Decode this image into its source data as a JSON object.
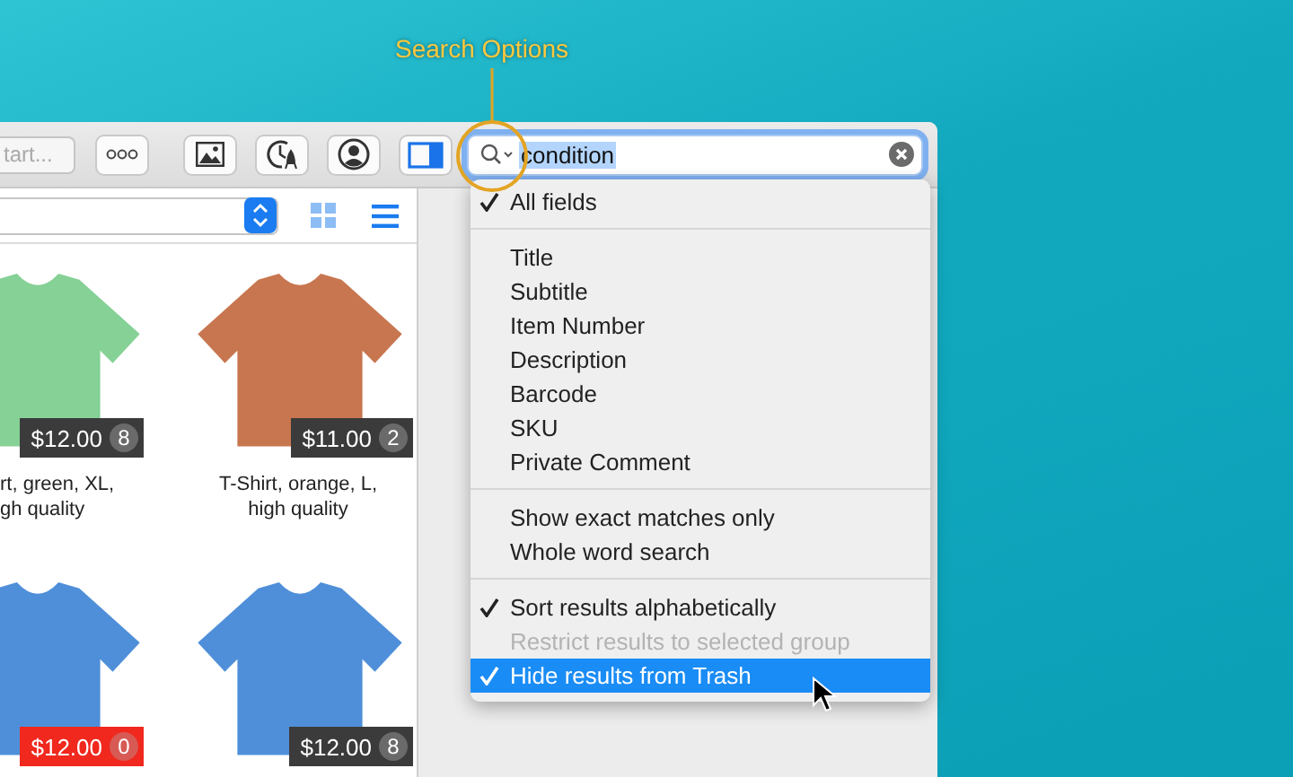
{
  "annotation": {
    "label": "Search Options"
  },
  "toolbar": {
    "start_field": {
      "placeholder": "tart..."
    },
    "buttons": [
      {
        "kind": "more"
      },
      {
        "kind": "image"
      },
      {
        "kind": "clock"
      },
      {
        "kind": "person"
      },
      {
        "kind": "sidebar",
        "on": true
      }
    ],
    "search": {
      "value": "condition",
      "text_selected": true
    }
  },
  "filter_bar": {
    "view_modes": [
      {
        "kind": "grid",
        "selected": false
      },
      {
        "kind": "list",
        "selected": true
      }
    ]
  },
  "products": [
    {
      "caption_lines": [
        "rt, green, XL,",
        "gh quality"
      ],
      "price": "$12.00",
      "count": "8",
      "color": "#85d196",
      "out_of_stock": false
    },
    {
      "caption_lines": [
        "T-Shirt, orange, L,",
        "high quality"
      ],
      "price": "$11.00",
      "count": "2",
      "color": "#c8764f",
      "out_of_stock": false
    },
    {
      "price": "$12.00",
      "count": "0",
      "color": "#4f8fd9",
      "out_of_stock": true
    },
    {
      "price": "$12.00",
      "count": "8",
      "color": "#4f8fd9",
      "out_of_stock": false
    }
  ],
  "search_menu": {
    "sections": [
      {
        "items": [
          {
            "label": "All fields",
            "checked": true,
            "disabled": false,
            "selected": false
          }
        ]
      },
      {
        "items": [
          {
            "label": "Title",
            "checked": false,
            "disabled": false,
            "selected": false
          },
          {
            "label": "Subtitle",
            "checked": false,
            "disabled": false,
            "selected": false
          },
          {
            "label": "Item Number",
            "checked": false,
            "disabled": false,
            "selected": false
          },
          {
            "label": "Description",
            "checked": false,
            "disabled": false,
            "selected": false
          },
          {
            "label": "Barcode",
            "checked": false,
            "disabled": false,
            "selected": false
          },
          {
            "label": "SKU",
            "checked": false,
            "disabled": false,
            "selected": false
          },
          {
            "label": "Private Comment",
            "checked": false,
            "disabled": false,
            "selected": false
          }
        ]
      },
      {
        "items": [
          {
            "label": "Show exact matches only",
            "checked": false,
            "disabled": false,
            "selected": false
          },
          {
            "label": "Whole word search",
            "checked": false,
            "disabled": false,
            "selected": false
          }
        ]
      },
      {
        "items": [
          {
            "label": "Sort results alphabetically",
            "checked": true,
            "disabled": false,
            "selected": false
          },
          {
            "label": "Restrict results to selected group",
            "checked": false,
            "disabled": true,
            "selected": false
          },
          {
            "label": "Hide results from Trash",
            "checked": true,
            "disabled": false,
            "selected": true
          }
        ]
      }
    ]
  }
}
